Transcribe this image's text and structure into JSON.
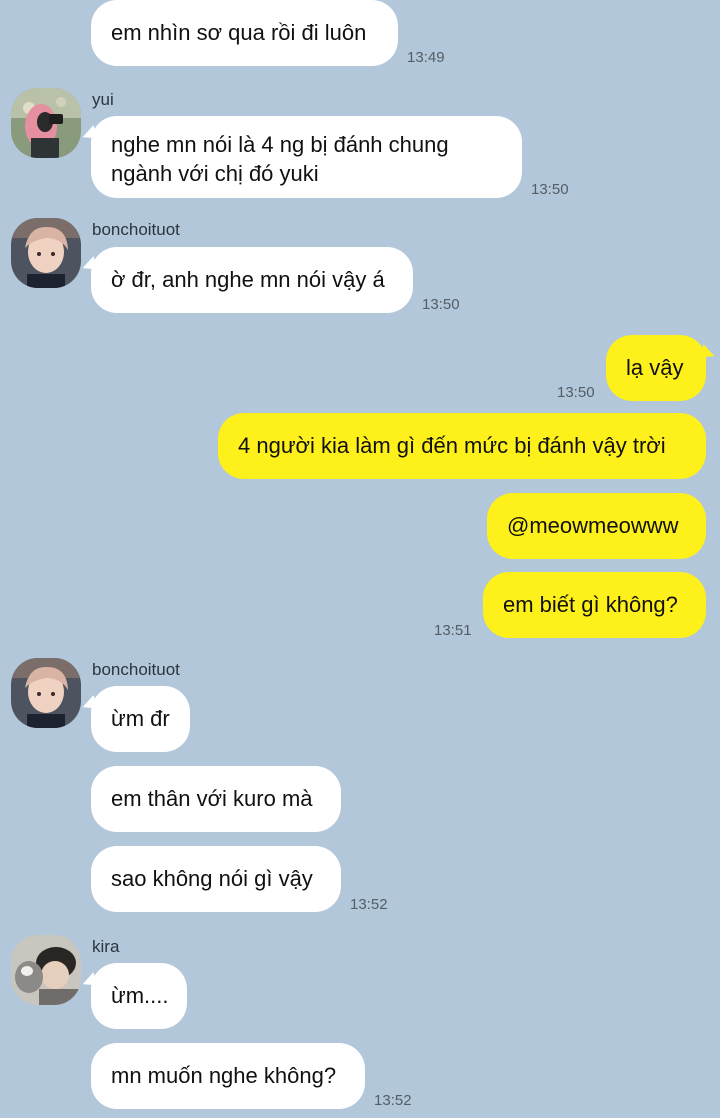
{
  "messages": [
    {
      "text": "em nhìn sơ qua rồi đi luôn",
      "time": "13:49"
    },
    {
      "sender": "yui",
      "text_line1": "nghe mn nói là 4 ng bị đánh chung",
      "text_line2": "ngành với chị đó yuki",
      "time": "13:50"
    },
    {
      "sender": "bonchoituot",
      "text": "ờ đr, anh nghe mn nói vậy á",
      "time": "13:50"
    },
    {
      "text": "lạ vậy",
      "time": "13:50"
    },
    {
      "text": "4 người kia làm gì đến mức bị đánh vậy trời"
    },
    {
      "text": "@meowmeowww"
    },
    {
      "text": "em biết gì không?",
      "time": "13:51"
    },
    {
      "sender": "bonchoituot",
      "text": "ừm đr"
    },
    {
      "text": "em thân với kuro mà"
    },
    {
      "text": "sao không nói gì vậy",
      "time": "13:52"
    },
    {
      "sender": "kira",
      "text": "ừm...."
    },
    {
      "text": "mn muốn nghe không?",
      "time": "13:52"
    }
  ],
  "colors": {
    "background": "#b2c7da",
    "incoming_bubble": "#ffffff",
    "outgoing_bubble": "#fef01b"
  }
}
